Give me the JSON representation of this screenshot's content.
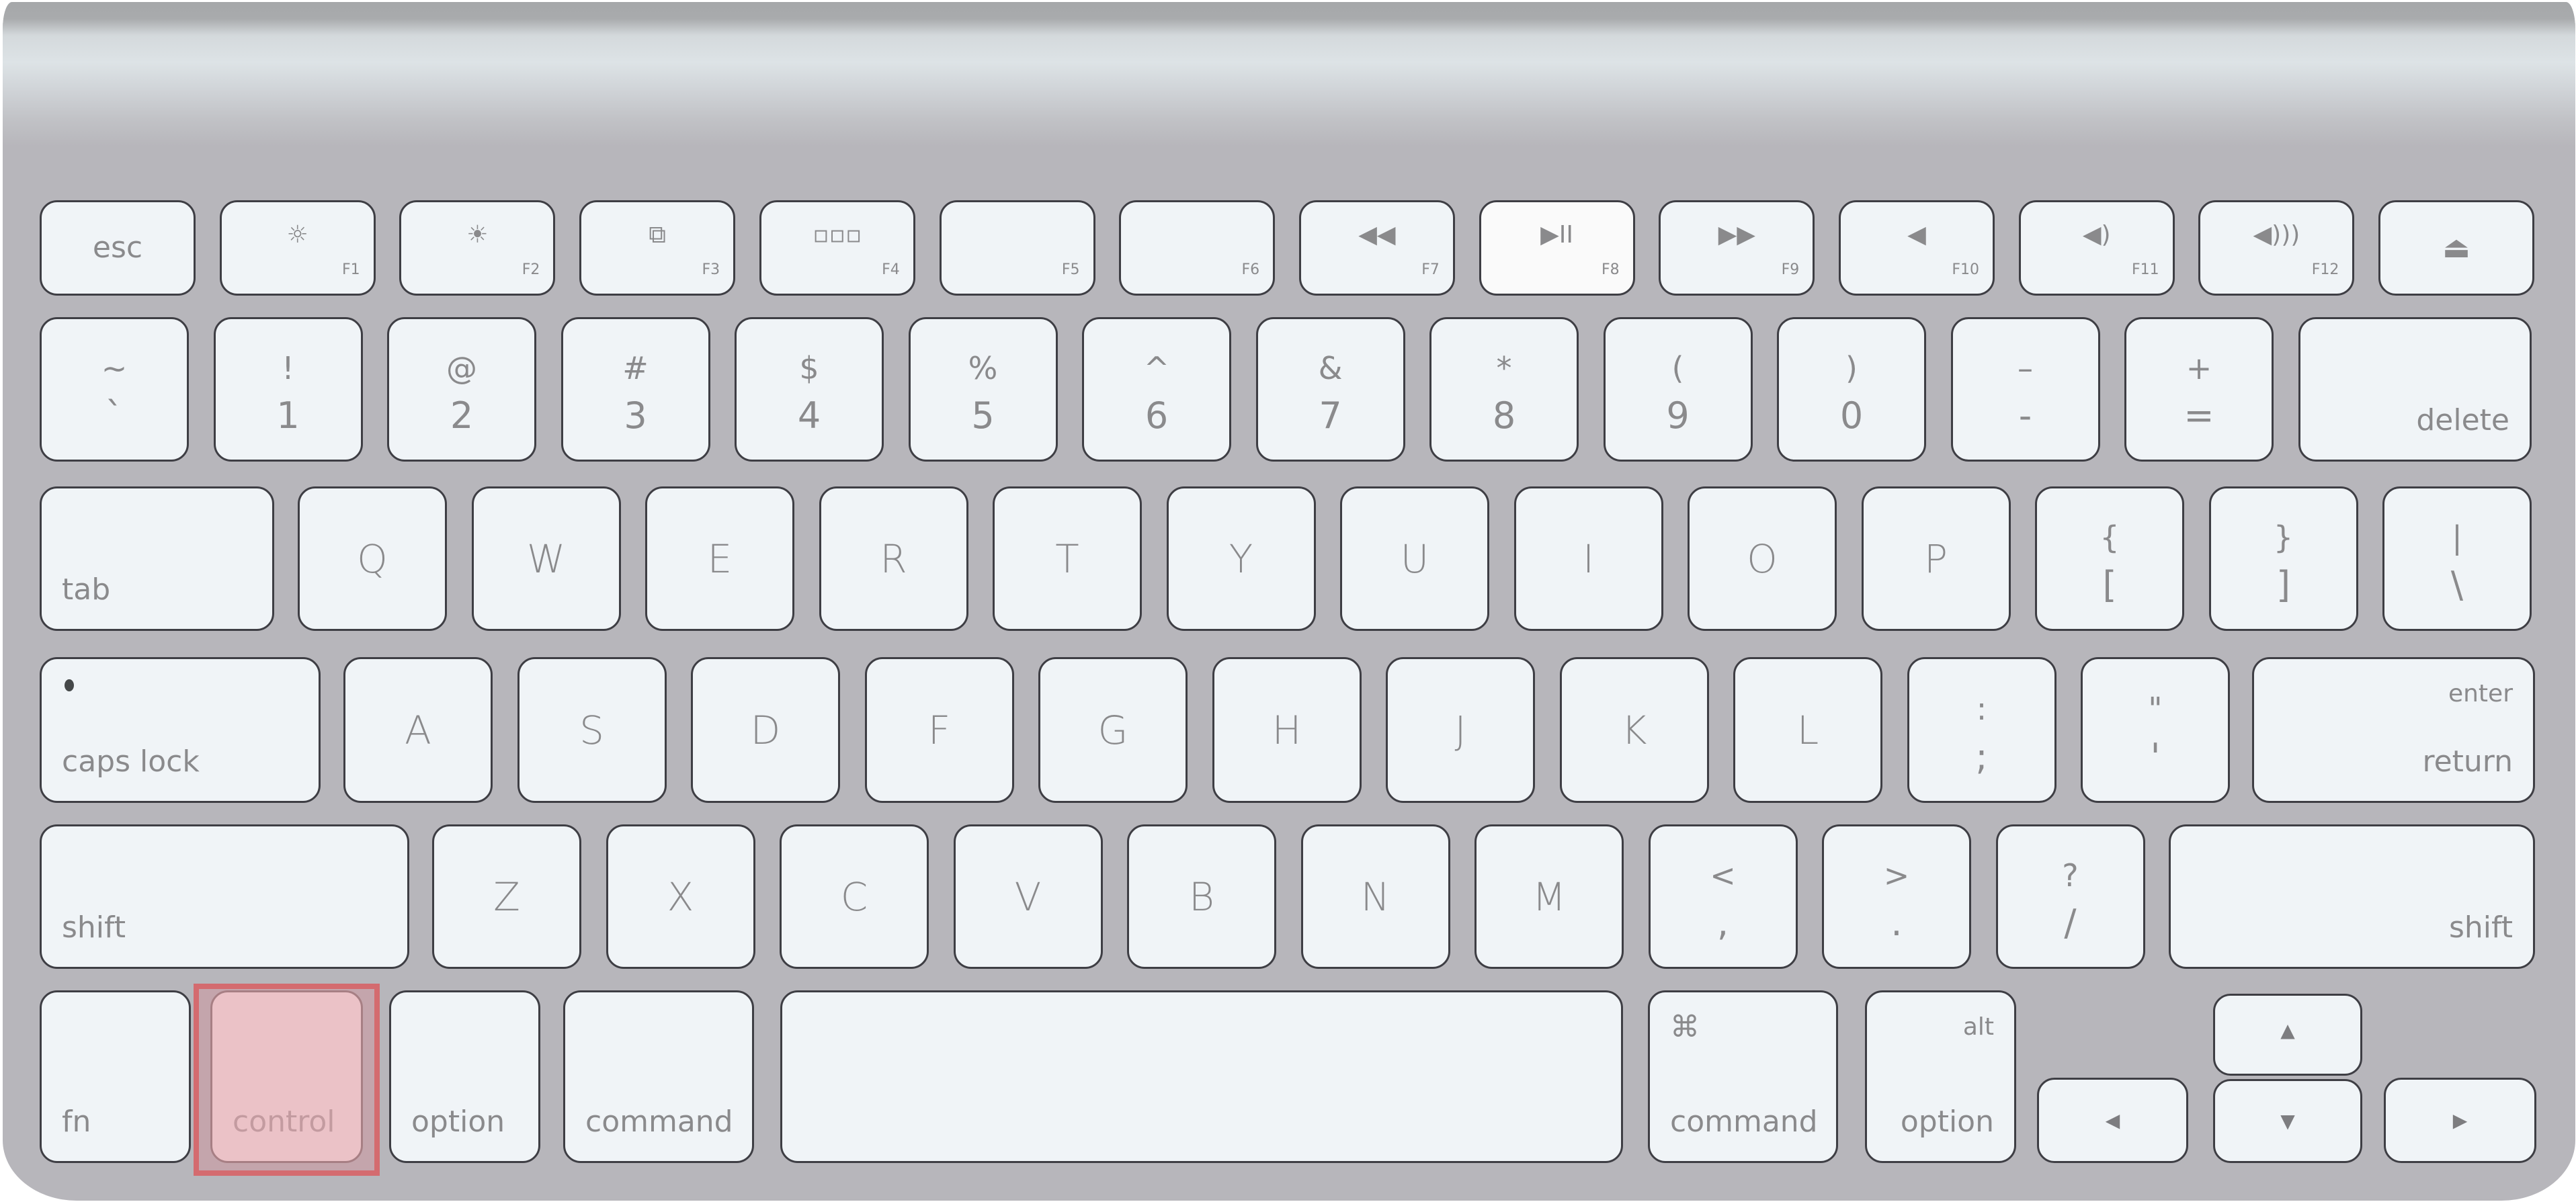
{
  "device": "Apple Wireless Keyboard (US layout)",
  "highlight": {
    "key_id": "control",
    "color": "#d46b6f",
    "label": "control"
  },
  "colors": {
    "keycap": "#f0f4f7",
    "keycap_lit": "#fafafa",
    "body": "#b7b6bb",
    "legend": "#8a8a8c",
    "outline": "#3e3e44"
  },
  "rows": {
    "function": [
      {
        "id": "esc",
        "label": "esc"
      },
      {
        "id": "f1",
        "icon": "brightness-down-icon",
        "glyph": "☼",
        "fn": "F1"
      },
      {
        "id": "f2",
        "icon": "brightness-up-icon",
        "glyph": "☀",
        "fn": "F2"
      },
      {
        "id": "f3",
        "icon": "mission-control-icon",
        "glyph": "⧉",
        "fn": "F3"
      },
      {
        "id": "f4",
        "icon": "launchpad-grid-icon",
        "glyph": "▫▫▫",
        "fn": "F4"
      },
      {
        "id": "f5",
        "icon": "",
        "glyph": "",
        "fn": "F5"
      },
      {
        "id": "f6",
        "icon": "",
        "glyph": "",
        "fn": "F6"
      },
      {
        "id": "f7",
        "icon": "rewind-icon",
        "glyph": "◀◀",
        "fn": "F7"
      },
      {
        "id": "f8",
        "icon": "play-pause-icon",
        "glyph": "▶II",
        "fn": "F8"
      },
      {
        "id": "f9",
        "icon": "fast-forward-icon",
        "glyph": "▶▶",
        "fn": "F9"
      },
      {
        "id": "f10",
        "icon": "mute-icon",
        "glyph": "◀",
        "fn": "F10"
      },
      {
        "id": "f11",
        "icon": "volume-down-icon",
        "glyph": "◀)",
        "fn": "F11"
      },
      {
        "id": "f12",
        "icon": "volume-up-icon",
        "glyph": "◀)))",
        "fn": "F12"
      },
      {
        "id": "eject",
        "icon": "eject-icon",
        "glyph": "⏏"
      }
    ],
    "number": [
      {
        "id": "backtick",
        "top": "~",
        "bottom": "`"
      },
      {
        "id": "1",
        "top": "!",
        "bottom": "1"
      },
      {
        "id": "2",
        "top": "@",
        "bottom": "2"
      },
      {
        "id": "3",
        "top": "#",
        "bottom": "3"
      },
      {
        "id": "4",
        "top": "$",
        "bottom": "4"
      },
      {
        "id": "5",
        "top": "%",
        "bottom": "5"
      },
      {
        "id": "6",
        "top": "^",
        "bottom": "6"
      },
      {
        "id": "7",
        "top": "&",
        "bottom": "7"
      },
      {
        "id": "8",
        "top": "*",
        "bottom": "8"
      },
      {
        "id": "9",
        "top": "(",
        "bottom": "9"
      },
      {
        "id": "0",
        "top": ")",
        "bottom": "0"
      },
      {
        "id": "minus",
        "top": "–",
        "bottom": "-"
      },
      {
        "id": "equals",
        "top": "+",
        "bottom": "="
      },
      {
        "id": "delete",
        "label": "delete"
      }
    ],
    "qwerty": [
      {
        "id": "tab",
        "label": "tab"
      },
      {
        "id": "q",
        "label": "Q"
      },
      {
        "id": "w",
        "label": "W"
      },
      {
        "id": "e",
        "label": "E"
      },
      {
        "id": "r",
        "label": "R"
      },
      {
        "id": "t",
        "label": "T"
      },
      {
        "id": "y",
        "label": "Y"
      },
      {
        "id": "u",
        "label": "U"
      },
      {
        "id": "i",
        "label": "I"
      },
      {
        "id": "o",
        "label": "O"
      },
      {
        "id": "p",
        "label": "P"
      },
      {
        "id": "lbracket",
        "top": "{",
        "bottom": "["
      },
      {
        "id": "rbracket",
        "top": "}",
        "bottom": "]"
      },
      {
        "id": "backslash",
        "top": "|",
        "bottom": "\\"
      }
    ],
    "home": [
      {
        "id": "caps_lock",
        "label": "caps lock"
      },
      {
        "id": "a",
        "label": "A"
      },
      {
        "id": "s",
        "label": "S"
      },
      {
        "id": "d",
        "label": "D"
      },
      {
        "id": "f",
        "label": "F"
      },
      {
        "id": "g",
        "label": "G"
      },
      {
        "id": "h",
        "label": "H"
      },
      {
        "id": "j",
        "label": "J"
      },
      {
        "id": "k",
        "label": "K"
      },
      {
        "id": "l",
        "label": "L"
      },
      {
        "id": "semicolon",
        "top": ":",
        "bottom": ";"
      },
      {
        "id": "quote",
        "top": "\"",
        "bottom": "'"
      },
      {
        "id": "return",
        "top_label": "enter",
        "label": "return"
      }
    ],
    "shift": [
      {
        "id": "left_shift",
        "label": "shift"
      },
      {
        "id": "z",
        "label": "Z"
      },
      {
        "id": "x",
        "label": "X"
      },
      {
        "id": "c",
        "label": "C"
      },
      {
        "id": "v",
        "label": "V"
      },
      {
        "id": "b",
        "label": "B"
      },
      {
        "id": "n",
        "label": "N"
      },
      {
        "id": "m",
        "label": "M"
      },
      {
        "id": "comma",
        "top": "<",
        "bottom": ","
      },
      {
        "id": "period",
        "top": ">",
        "bottom": "."
      },
      {
        "id": "slash",
        "top": "?",
        "bottom": "/"
      },
      {
        "id": "right_shift",
        "label": "shift"
      }
    ],
    "bottom": [
      {
        "id": "fn",
        "label": "fn"
      },
      {
        "id": "control",
        "label": "control"
      },
      {
        "id": "left_option",
        "label": "option"
      },
      {
        "id": "left_command",
        "label": "command"
      },
      {
        "id": "space",
        "label": ""
      },
      {
        "id": "right_command",
        "symbol": "⌘",
        "label": "command"
      },
      {
        "id": "right_option",
        "top_label": "alt",
        "label": "option"
      },
      {
        "id": "arrow_left",
        "glyph": "◀"
      },
      {
        "id": "arrow_up",
        "glyph": "▲"
      },
      {
        "id": "arrow_down",
        "glyph": "▼"
      },
      {
        "id": "arrow_right",
        "glyph": "▶"
      }
    ]
  }
}
